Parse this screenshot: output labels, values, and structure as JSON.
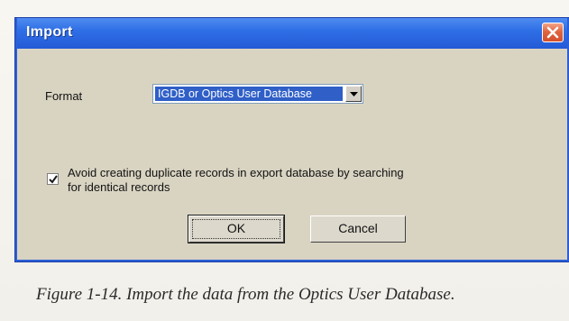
{
  "dialog": {
    "title": "Import",
    "close_icon": "close-icon",
    "format_label": "Format",
    "format_value": "IGDB or Optics User Database",
    "checkbox_checked": true,
    "checkbox_label_line1": "Avoid creating duplicate records in export database by searching",
    "checkbox_label_line2": "for identical records",
    "ok_label": "OK",
    "cancel_label": "Cancel"
  },
  "caption": "Figure 1-14. Import the data from the Optics User Database.",
  "colors": {
    "titlebar": "#2f6fe6",
    "dialog_bg": "#d9d4c2",
    "selection": "#2f5fc7",
    "close_button": "#e0653f"
  }
}
